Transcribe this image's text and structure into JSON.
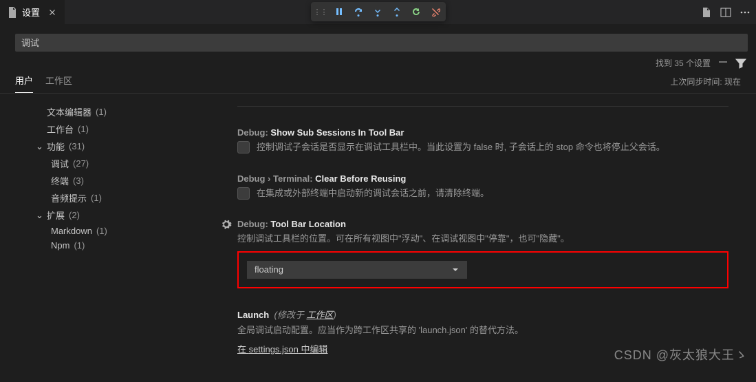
{
  "tab": {
    "title": "设置"
  },
  "search": {
    "query": "调试",
    "result_count": "找到 35 个设置"
  },
  "scope": {
    "user": "用户",
    "workspace": "工作区",
    "sync": "上次同步时间: 现在"
  },
  "sidebar": {
    "items": [
      {
        "label": "文本编辑器",
        "count": "(1)",
        "lvl": 1
      },
      {
        "label": "工作台",
        "count": "(1)",
        "lvl": 1
      },
      {
        "label": "功能",
        "count": "(31)",
        "lvl": 1,
        "expand": true
      },
      {
        "label": "调试",
        "count": "(27)",
        "lvl": 2
      },
      {
        "label": "终端",
        "count": "(3)",
        "lvl": 2
      },
      {
        "label": "音频提示",
        "count": "(1)",
        "lvl": 2
      },
      {
        "label": "扩展",
        "count": "(2)",
        "lvl": 1,
        "expand": true
      },
      {
        "label": "Markdown",
        "count": "(1)",
        "lvl": 2
      },
      {
        "label": "Npm",
        "count": "(1)",
        "lvl": 2
      }
    ]
  },
  "settings": {
    "s1": {
      "scope": "Debug:",
      "name": "Show Sub Sessions In Tool Bar",
      "desc": "控制调试子会话是否显示在调试工具栏中。当此设置为 false 时, 子会话上的 stop 命令也将停止父会话。"
    },
    "s2": {
      "scope": "Debug › Terminal:",
      "name": "Clear Before Reusing",
      "desc": "在集成或外部终端中启动新的调试会话之前，请清除终端。"
    },
    "s3": {
      "scope": "Debug:",
      "name": "Tool Bar Location",
      "desc": "控制调试工具栏的位置。可在所有视图中\"浮动\"、在调试视图中\"停靠\"，也可\"隐藏\"。",
      "value": "floating"
    },
    "s4": {
      "scope": "Launch",
      "modified_prefix": "(修改于",
      "modified_link": "工作区",
      "modified_suffix": ")",
      "desc": "全局调试启动配置。应当作为跨工作区共享的 'launch.json' 的替代方法。",
      "link_prefix": "在 ",
      "link": "settings.json",
      "link_suffix": " 中编辑"
    }
  },
  "watermark": "CSDN @灰太狼大王ゝ"
}
